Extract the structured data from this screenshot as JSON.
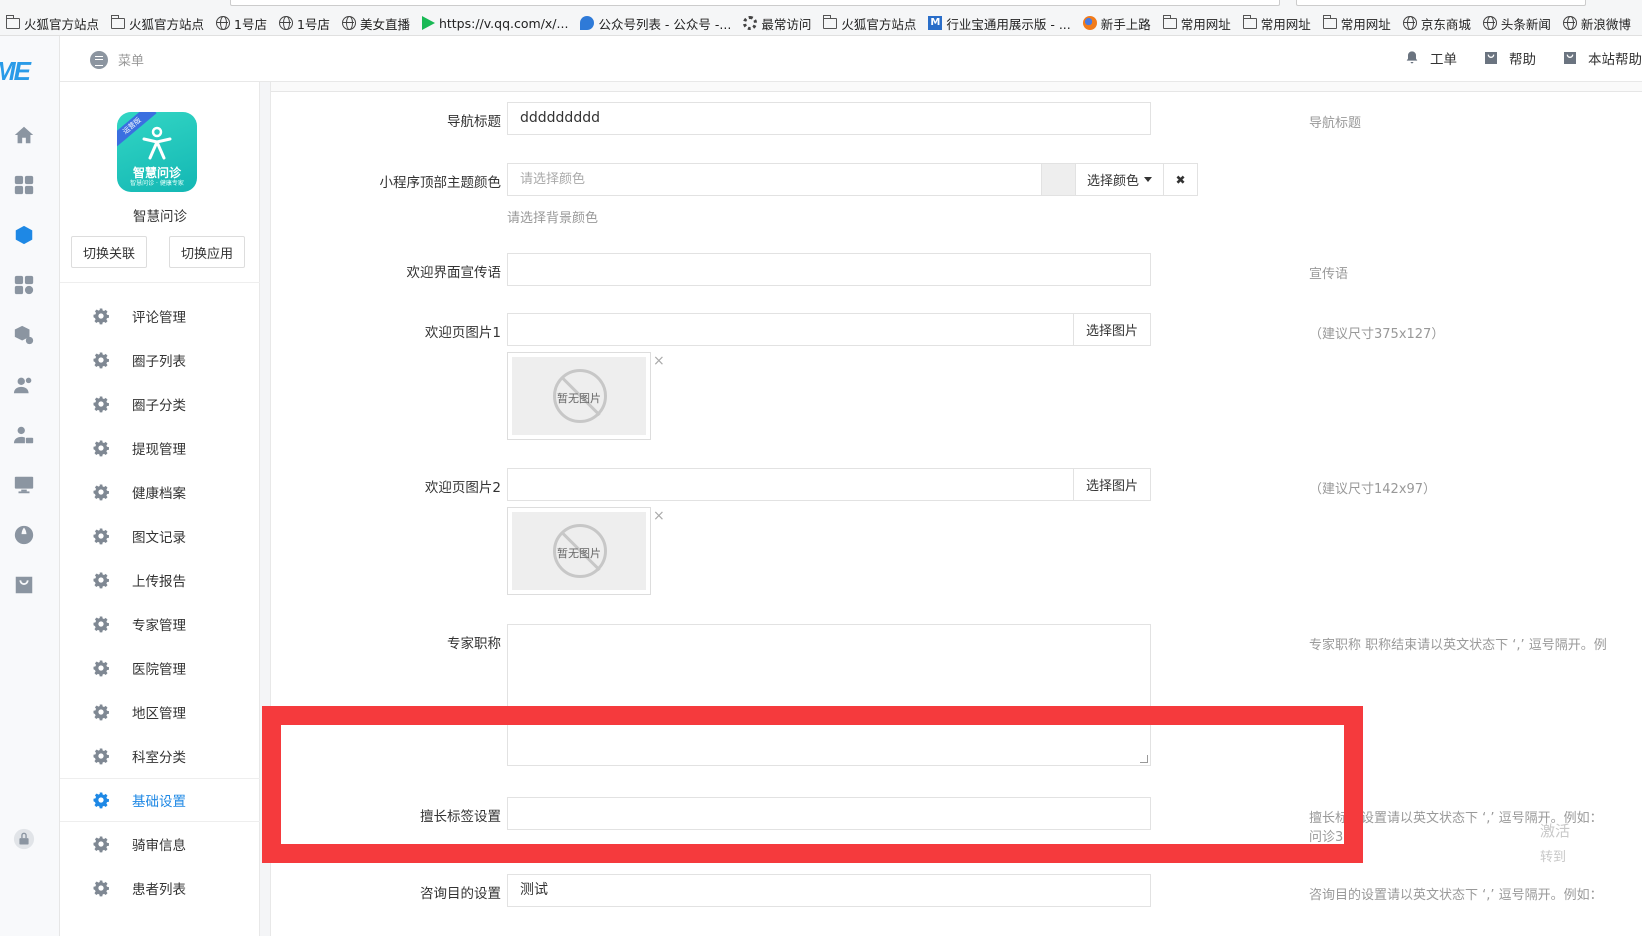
{
  "bookmarks": [
    {
      "label": "火狐官方站点",
      "icon": "folder-icon"
    },
    {
      "label": "火狐官方站点",
      "icon": "folder-icon"
    },
    {
      "label": "1号店",
      "icon": "globe-icon"
    },
    {
      "label": "1号店",
      "icon": "globe-icon"
    },
    {
      "label": "美女直播",
      "icon": "globe-icon"
    },
    {
      "label": "https://v.qq.com/x/...",
      "icon": "play-icon"
    },
    {
      "label": "公众号列表 - 公众号 -...",
      "icon": "bird-icon"
    },
    {
      "label": "最常访问",
      "icon": "gear-icon"
    },
    {
      "label": "火狐官方站点",
      "icon": "folder-icon"
    },
    {
      "label": "行业宝通用展示版 - ...",
      "icon": "m-icon"
    },
    {
      "label": "新手上路",
      "icon": "firefox-icon"
    },
    {
      "label": "常用网址",
      "icon": "folder-icon"
    },
    {
      "label": "常用网址",
      "icon": "folder-icon"
    },
    {
      "label": "常用网址",
      "icon": "folder-icon"
    },
    {
      "label": "京东商城",
      "icon": "globe-icon"
    },
    {
      "label": "头条新闻",
      "icon": "globe-icon"
    },
    {
      "label": "新浪微博",
      "icon": "globe-icon"
    }
  ],
  "rail": {
    "logo": "ME"
  },
  "header": {
    "menu_label": "菜单",
    "links": [
      {
        "label": "工单",
        "icon": "bell-icon"
      },
      {
        "label": "帮助",
        "icon": "bag-icon"
      },
      {
        "label": "本站帮助",
        "icon": "bag-icon"
      }
    ]
  },
  "sidebar": {
    "app_logo_ribbon": "运营版",
    "app_logo_caption": "智慧问诊",
    "app_logo_sub": "智慧问诊 · 健康专家",
    "app_name": "智慧问诊",
    "btn_switch_link": "切换关联",
    "btn_switch_app": "切换应用",
    "items": [
      {
        "label": "评论管理",
        "active": false
      },
      {
        "label": "圈子列表",
        "active": false
      },
      {
        "label": "圈子分类",
        "active": false
      },
      {
        "label": "提现管理",
        "active": false
      },
      {
        "label": "健康档案",
        "active": false
      },
      {
        "label": "图文记录",
        "active": false
      },
      {
        "label": "上传报告",
        "active": false
      },
      {
        "label": "专家管理",
        "active": false
      },
      {
        "label": "医院管理",
        "active": false
      },
      {
        "label": "地区管理",
        "active": false
      },
      {
        "label": "科室分类",
        "active": false
      },
      {
        "label": "基础设置",
        "active": true
      },
      {
        "label": "骑审信息",
        "active": false
      },
      {
        "label": "患者列表",
        "active": false
      }
    ]
  },
  "form": {
    "nav_title": {
      "label": "导航标题",
      "value": "ddddddddd",
      "help": "导航标题"
    },
    "theme_color": {
      "label": "小程序顶部主题颜色",
      "placeholder": "请选择颜色",
      "pick_label": "选择颜色",
      "clear_label": "✖",
      "help": "请选择背景颜色"
    },
    "welcome_slogan": {
      "label": "欢迎界面宣传语",
      "value": "",
      "help": "宣传语"
    },
    "welcome_img1": {
      "label": "欢迎页图片1",
      "pick_label": "选择图片",
      "no_image": "暂无图片",
      "remove": "×",
      "help": "（建议尺寸375x127）"
    },
    "welcome_img2": {
      "label": "欢迎页图片2",
      "pick_label": "选择图片",
      "no_image": "暂无图片",
      "remove": "×",
      "help": "（建议尺寸142x97）"
    },
    "expert_title": {
      "label": "专家职称",
      "help": "专家职称 职称结束请以英文状态下 ‘,’ 逗号隔开。例"
    },
    "skill_tags": {
      "label": "擅长标签设置",
      "value": "",
      "help_line1": "擅长标签设置请以英文状态下 ‘,’ 逗号隔开。例如：",
      "help_line2": "问诊3"
    },
    "consult_purpose": {
      "label": "咨询目的设置",
      "value": "测试",
      "help": "咨询目的设置请以英文状态下 ‘,’ 逗号隔开。例如："
    }
  },
  "edge_text": {
    "line1": "激活",
    "line2": "转到"
  },
  "colors": {
    "accent": "#1e88e5",
    "highlight": "#f53a3d"
  }
}
